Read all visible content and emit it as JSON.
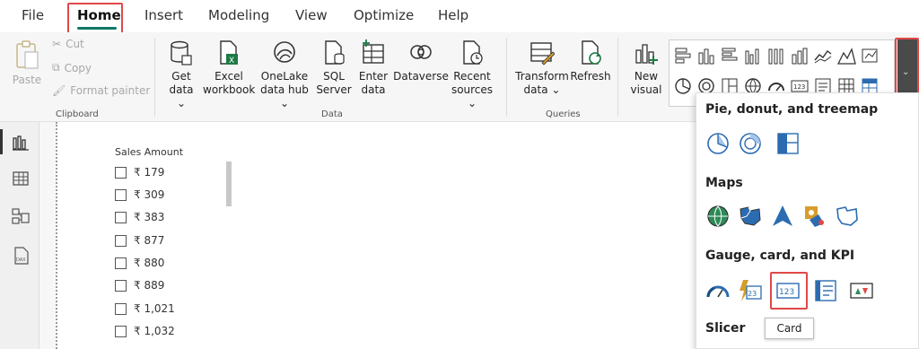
{
  "menu": {
    "items": [
      "File",
      "Home",
      "Insert",
      "Modeling",
      "View",
      "Optimize",
      "Help"
    ],
    "active": "Home"
  },
  "ribbon": {
    "clipboard": {
      "paste_label": "Paste",
      "cut_label": "Cut",
      "copy_label": "Copy",
      "format_painter_label": "Format painter",
      "group_label": "Clipboard"
    },
    "data": {
      "get_data": [
        "Get",
        "data"
      ],
      "excel": [
        "Excel",
        "workbook"
      ],
      "onelake": [
        "OneLake",
        "data hub"
      ],
      "sql": [
        "SQL",
        "Server"
      ],
      "enter": [
        "Enter",
        "data"
      ],
      "dataverse": [
        "Dataverse"
      ],
      "recent": [
        "Recent",
        "sources"
      ],
      "group_label": "Data"
    },
    "queries": {
      "transform": [
        "Transform",
        "data"
      ],
      "refresh": [
        "Refresh"
      ],
      "group_label": "Queries"
    },
    "insert": {
      "new_visual": [
        "New",
        "visual"
      ]
    }
  },
  "canvas": {
    "slicer": {
      "title": "Sales Amount",
      "items": [
        "₹ 179",
        "₹ 309",
        "₹ 383",
        "₹ 877",
        "₹ 880",
        "₹ 889",
        "₹ 1,021",
        "₹ 1,032"
      ]
    }
  },
  "visuals_panel": {
    "sections": [
      {
        "title": "Pie, donut, and treemap",
        "icons": [
          "pie-chart-icon",
          "donut-chart-icon",
          "treemap-icon"
        ]
      },
      {
        "title": "Maps",
        "icons": [
          "globe-map-icon",
          "filled-map-icon",
          "azure-map-icon",
          "shape-map-icon",
          "outline-map-icon"
        ]
      },
      {
        "title": "Gauge, card, and KPI",
        "icons": [
          "gauge-icon",
          "multi-row-card-icon",
          "card-icon",
          "list-card-icon",
          "kpi-icon"
        ]
      },
      {
        "title": "Slicer",
        "icons": []
      }
    ],
    "tooltip": "Card"
  },
  "colors": {
    "accent": "#117865",
    "highlight": "#e04848",
    "icon_blue": "#2b6cb0",
    "icon_dark": "#333333"
  }
}
